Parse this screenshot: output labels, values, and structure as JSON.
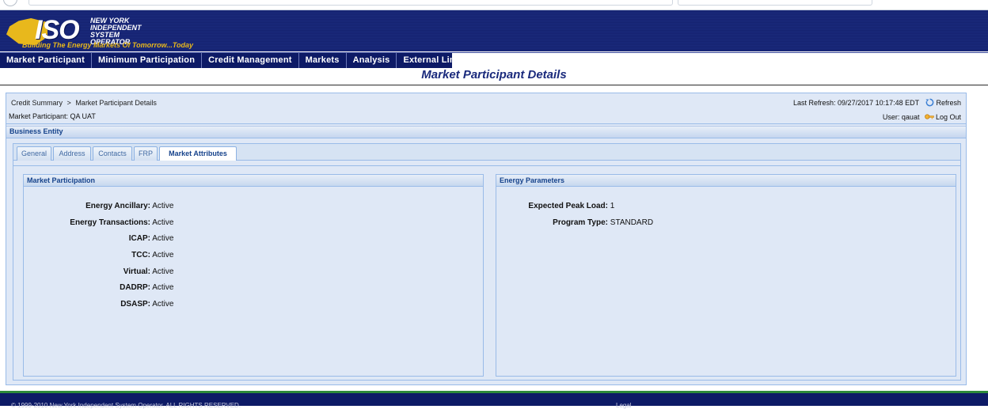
{
  "header": {
    "logo_text": "ISO",
    "org_name": "NEW YORK INDEPENDENT SYSTEM OPERATOR",
    "tagline": "Building The Energy Markets Of Tomorrow...Today"
  },
  "nav": {
    "items": [
      "Market Participant",
      "Minimum Participation",
      "Credit Management",
      "Markets",
      "Analysis",
      "External Links"
    ]
  },
  "page_title": "Market Participant Details",
  "breadcrumb": {
    "parent": "Credit Summary",
    "separator": ">",
    "current": "Market Participant Details"
  },
  "market_participant": "Market Participant: QA UAT",
  "refresh": {
    "label": "Last Refresh:",
    "timestamp": "09/27/2017 10:17:48 EDT",
    "button": "Refresh"
  },
  "user": {
    "label": "User:",
    "name": "qauat",
    "logout": "Log Out"
  },
  "section_title": "Business Entity",
  "tabs": [
    "General",
    "Address",
    "Contacts",
    "FRP",
    "Market Attributes"
  ],
  "active_tab": "Market Attributes",
  "market_participation": {
    "title": "Market Participation",
    "rows": [
      {
        "label": "Energy Ancillary:",
        "value": "Active"
      },
      {
        "label": "Energy Transactions:",
        "value": "Active"
      },
      {
        "label": "ICAP:",
        "value": "Active"
      },
      {
        "label": "TCC:",
        "value": "Active"
      },
      {
        "label": "Virtual:",
        "value": "Active"
      },
      {
        "label": "DADRP:",
        "value": "Active"
      },
      {
        "label": "DSASP:",
        "value": "Active"
      }
    ]
  },
  "energy_parameters": {
    "title": "Energy Parameters",
    "rows": [
      {
        "label": "Expected Peak Load:",
        "value": "1"
      },
      {
        "label": "Program Type:",
        "value": "STANDARD"
      }
    ]
  },
  "footer": {
    "copyright": "© 1999-2010 New York Independent System Operator. ALL RIGHTS RESERVED.",
    "legal": "Legal"
  },
  "colors": {
    "nav_bg": "#0d1a66",
    "banner_bg": "#1a2a7c",
    "accent_gold": "#e8b81c",
    "panel_bg": "#dfe8f6",
    "header_text": "#15428b"
  }
}
